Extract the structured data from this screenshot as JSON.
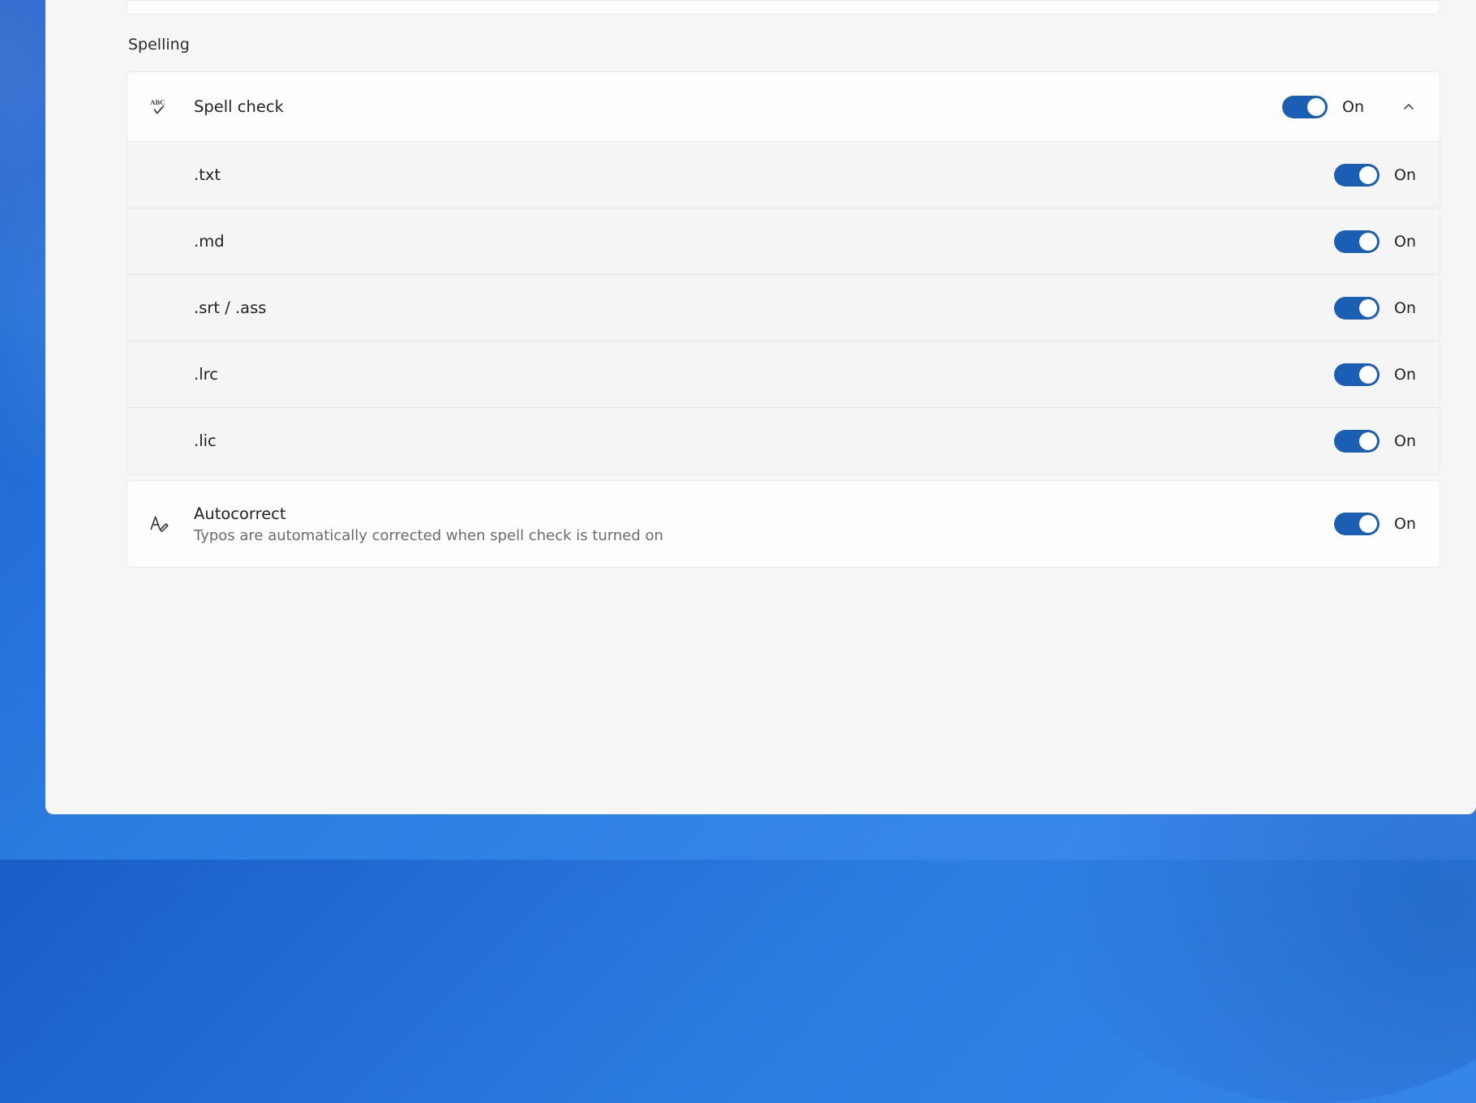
{
  "section": {
    "title": "Spelling"
  },
  "spellcheck": {
    "label": "Spell check",
    "state_label": "On",
    "expanded": true,
    "items": [
      {
        "label": ".txt",
        "state_label": "On"
      },
      {
        "label": ".md",
        "state_label": "On"
      },
      {
        "label": ".srt / .ass",
        "state_label": "On"
      },
      {
        "label": ".lrc",
        "state_label": "On"
      },
      {
        "label": ".lic",
        "state_label": "On"
      }
    ]
  },
  "autocorrect": {
    "label": "Autocorrect",
    "description": "Typos are automatically corrected when spell check is turned on",
    "state_label": "On"
  },
  "icons": {
    "abc_check": "abc-check-icon",
    "font_edit": "font-edit-icon",
    "chevron_up": "chevron-up-icon"
  }
}
